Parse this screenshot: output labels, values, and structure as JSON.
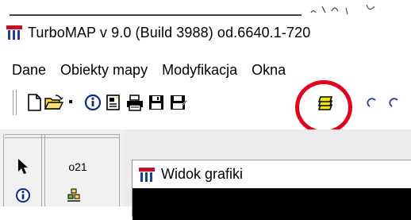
{
  "window": {
    "title": "TurboMAP v 9.0 (Build 3988)  od.6640.1-720"
  },
  "menu": [
    {
      "label": "Dane"
    },
    {
      "label": "Obiekty mapy"
    },
    {
      "label": "Modyfikacja"
    },
    {
      "label": "Okna"
    }
  ],
  "toolbar": {
    "buttons": [
      {
        "icon": "new-document-icon"
      },
      {
        "icon": "open-folder-icon"
      },
      {
        "icon": "dropdown-arrow-icon"
      },
      {
        "icon": "info-icon"
      },
      {
        "icon": "document-properties-icon"
      },
      {
        "icon": "printer-icon"
      },
      {
        "icon": "save-icon"
      },
      {
        "icon": "save-as-icon"
      },
      {
        "icon": "layers-icon"
      },
      {
        "icon": "undo-icon"
      },
      {
        "icon": "redo-icon"
      }
    ],
    "highlight_color": "#e3001b",
    "layers_color": "#f2e600"
  },
  "tools": {
    "coordinate_label": "o21"
  },
  "child_window": {
    "title": "Widok grafiki"
  },
  "colors": {
    "app_icon_red": "#c8102e",
    "app_icon_blue": "#1f3f9a",
    "child_icon_red": "#c8102e"
  }
}
